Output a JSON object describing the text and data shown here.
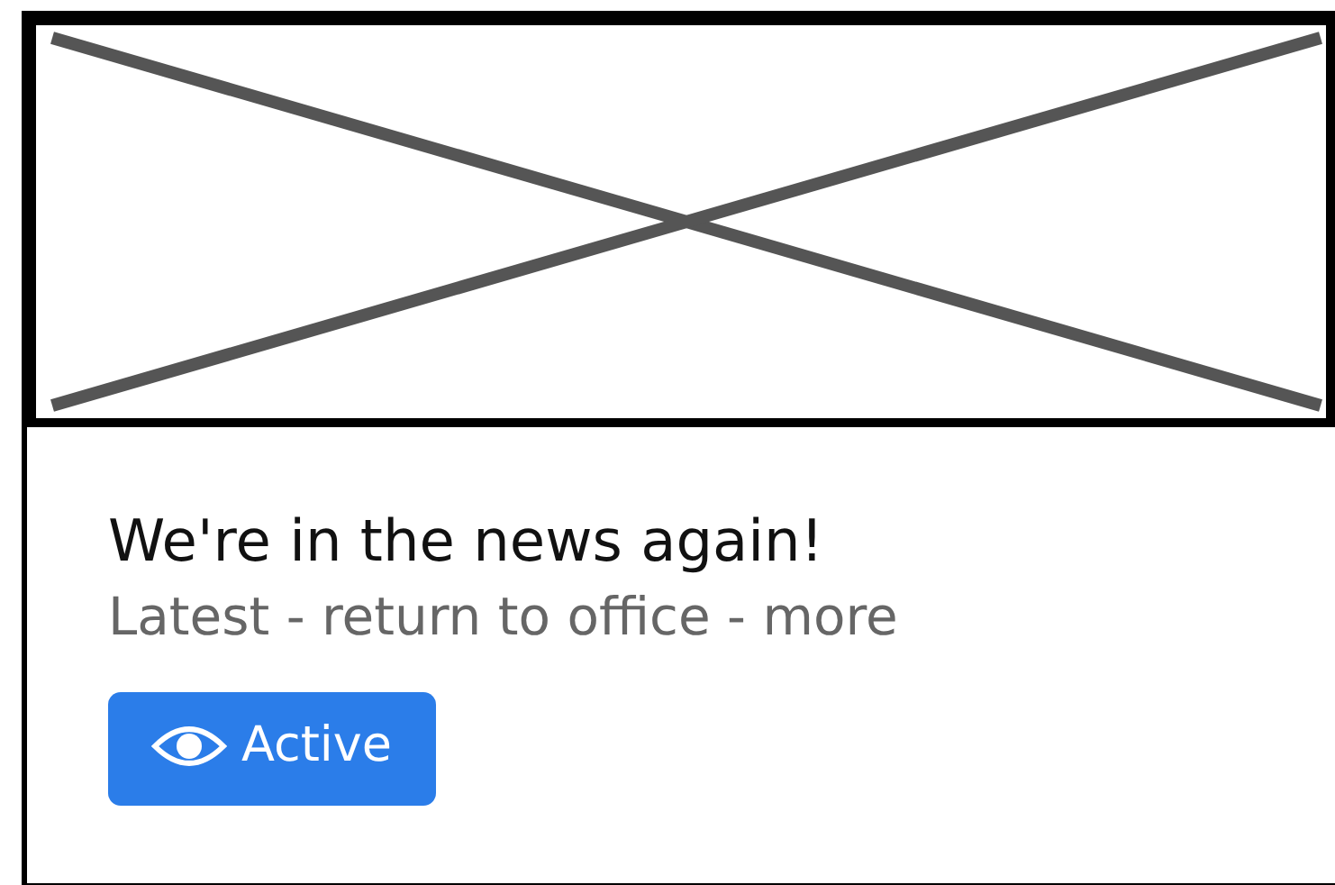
{
  "card": {
    "image": {
      "kind": "placeholder"
    },
    "title": "We're in the news again!",
    "subtitle": "Latest - return to office - more",
    "button": {
      "label": "Active"
    }
  }
}
